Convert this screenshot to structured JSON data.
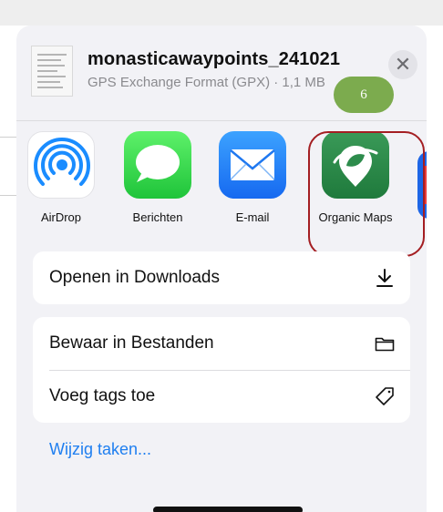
{
  "header": {
    "file_name": "monasticawaypoints_241021",
    "file_meta": "GPS Exchange Format (GPX) · 1,1 MB",
    "close_label": "✕"
  },
  "annotation": {
    "badge_text": "6",
    "badge_color": "#7cab4e",
    "highlight_color": "#a41e22"
  },
  "apps": [
    {
      "label": "AirDrop",
      "icon": "airdrop-icon"
    },
    {
      "label": "Berichten",
      "icon": "messages-icon"
    },
    {
      "label": "E-mail",
      "icon": "mail-icon"
    },
    {
      "label": "Organic Maps",
      "icon": "organic-maps-icon"
    }
  ],
  "actions": [
    {
      "label": "Openen in Downloads",
      "icon": "download-icon"
    },
    {
      "label": "Bewaar in Bestanden",
      "icon": "folder-icon"
    },
    {
      "label": "Voeg tags toe",
      "icon": "tag-icon"
    }
  ],
  "edit_actions_label": "Wijzig taken...",
  "colors": {
    "link": "#1f7ff0",
    "sheet": "#f2f2f6"
  }
}
